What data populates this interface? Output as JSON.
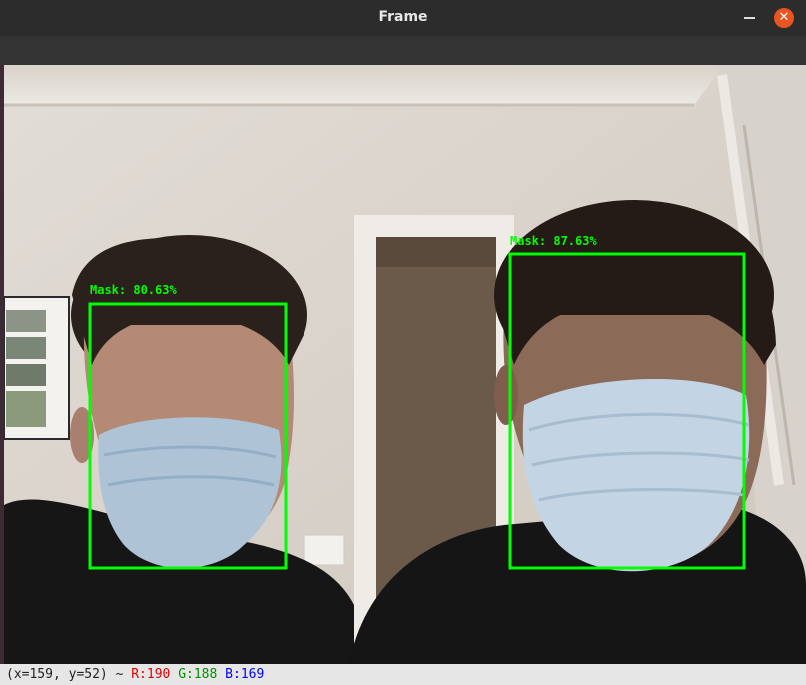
{
  "window": {
    "title": "Frame",
    "close_glyph": "✕"
  },
  "detections": [
    {
      "label": "Mask: 80.63%",
      "color": "#00ff00"
    },
    {
      "label": "Mask: 87.63%",
      "color": "#00ff00"
    }
  ],
  "status": {
    "coords": "(x=159, y=52) ~",
    "r": "R:190",
    "g": "G:188",
    "b": "B:169"
  },
  "colors": {
    "box": "#00ff00",
    "close_button": "#e95420"
  }
}
